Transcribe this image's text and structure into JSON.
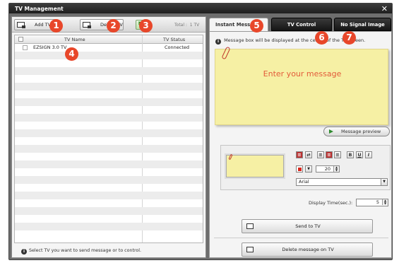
{
  "window": {
    "title": "TV Management",
    "close_glyph": "✕"
  },
  "toolbar": {
    "add_label": "Add TV",
    "delete_label": "Delete TV",
    "refresh_glyph": "↻",
    "total_label": "Total :",
    "total_value": "1 TV"
  },
  "grid": {
    "col_name": "TV Name",
    "col_status": "TV Status",
    "rows": [
      {
        "name": "EZSIGN 3.0 TV",
        "status": "Connected"
      }
    ]
  },
  "hint": {
    "info_glyph": "i",
    "text": "Select TV you want to send message or to control."
  },
  "tabs": [
    {
      "label": "Instant Message",
      "active": true
    },
    {
      "label": "TV Control",
      "active": false
    },
    {
      "label": "No Signal Image",
      "active": false
    }
  ],
  "instant": {
    "info_glyph": "i",
    "info_text": "Message box will be displayed at the center of the TV screen.",
    "message_placeholder": "Enter your message",
    "preview_label": "Message preview",
    "format": {
      "font_size": "20",
      "font_name": "Arial",
      "buttons": [
        "B",
        "U",
        "I"
      ]
    },
    "display_time_label": "Display Time(sec.):",
    "display_time_value": "5",
    "send_label": "Send to TV",
    "delete_label": "Delete message on TV"
  },
  "badges": [
    "1",
    "2",
    "3",
    "4",
    "5",
    "6",
    "7"
  ],
  "colors": {
    "badge": "#e8472a",
    "text_color": "#d9251c",
    "note": "#f6f0a4"
  }
}
